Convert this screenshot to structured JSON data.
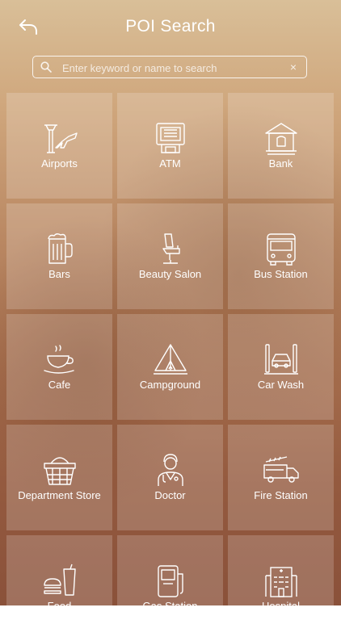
{
  "header": {
    "title": "POI Search",
    "back_icon": "back-arrow-icon"
  },
  "search": {
    "placeholder": "Enter keyword or name to search",
    "value": "",
    "clear_label": "×"
  },
  "categories": [
    {
      "label": "Airports",
      "icon": "airport-icon"
    },
    {
      "label": "ATM",
      "icon": "atm-icon"
    },
    {
      "label": "Bank",
      "icon": "bank-icon"
    },
    {
      "label": "Bars",
      "icon": "beer-mug-icon"
    },
    {
      "label": "Beauty Salon",
      "icon": "salon-chair-icon"
    },
    {
      "label": "Bus Station",
      "icon": "bus-icon"
    },
    {
      "label": "Cafe",
      "icon": "coffee-cup-icon"
    },
    {
      "label": "Campground",
      "icon": "tent-icon"
    },
    {
      "label": "Car Wash",
      "icon": "car-wash-icon"
    },
    {
      "label": "Department Store",
      "icon": "shopping-basket-icon"
    },
    {
      "label": "Doctor",
      "icon": "doctor-icon"
    },
    {
      "label": "Fire Station",
      "icon": "fire-truck-icon"
    },
    {
      "label": "Food",
      "icon": "burger-drink-icon"
    },
    {
      "label": "Gas Station",
      "icon": "gas-pump-icon"
    },
    {
      "label": "Hospital",
      "icon": "hospital-building-icon"
    }
  ]
}
